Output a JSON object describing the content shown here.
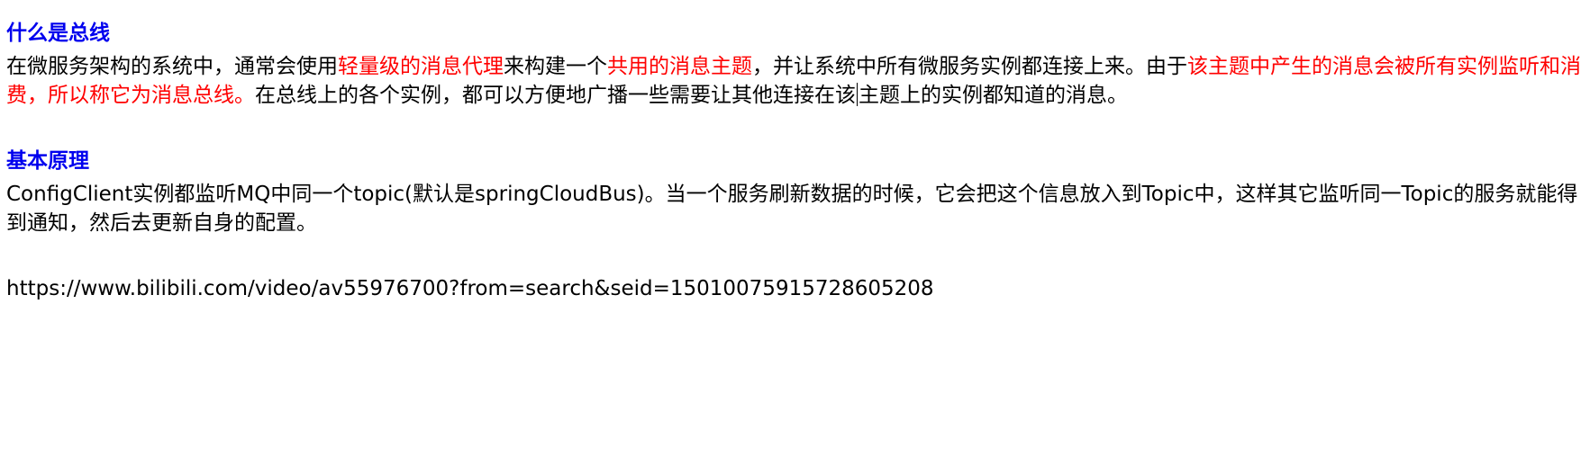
{
  "section1": {
    "heading": "什么是总线",
    "paragraph": [
      {
        "text": "在微服务架构的系统中，通常会使用",
        "color": "black"
      },
      {
        "text": "轻量级的消息代理",
        "color": "red"
      },
      {
        "text": "来构建一个",
        "color": "black"
      },
      {
        "text": "共用的消息主题",
        "color": "red"
      },
      {
        "text": "，并让系统中所有微服务实例都连接上来。由于",
        "color": "black"
      },
      {
        "text": "该主题中产生的消息会被所有实例监听和消费，所以称它为消息总线。",
        "color": "red"
      },
      {
        "text": "在总线上的各个实例，都可以方便地广播一些需要让其他连接在该",
        "color": "black"
      },
      {
        "text": "主题上的实例都知道的消息。",
        "color": "black"
      }
    ]
  },
  "section2": {
    "heading": "基本原理",
    "paragraph": "ConfigClient实例都监听MQ中同一个topic(默认是springCloudBus)。当一个服务刷新数据的时候，它会把这个信息放入到Topic中，这样其它监听同一Topic的服务就能得到通知，然后去更新自身的配置。"
  },
  "link": {
    "url": "https://www.bilibili.com/video/av55976700?from=search&seid=15010075915728605208"
  },
  "colors": {
    "heading": "#0000ee",
    "highlight": "#ff0000",
    "text": "#000000"
  }
}
